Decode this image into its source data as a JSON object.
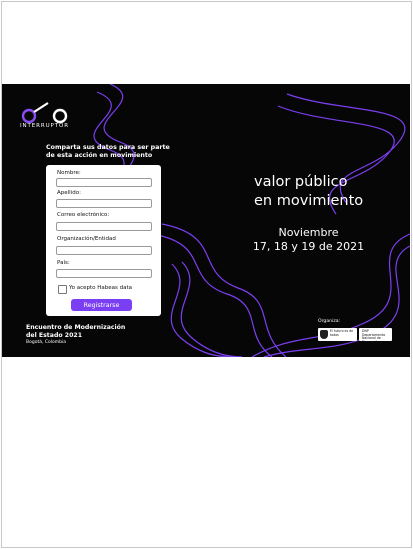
{
  "logo": {
    "text": "INTERRUPTOR"
  },
  "form": {
    "title": "Comparta sus datos para ser parte de esta acción en movimiento",
    "fields": [
      {
        "label": "Nombre:",
        "value": ""
      },
      {
        "label": "Apellido:",
        "value": ""
      },
      {
        "label": "Correo electrónico:",
        "value": ""
      },
      {
        "label": "Organización/Entidad",
        "value": ""
      },
      {
        "label": "País:",
        "value": ""
      }
    ],
    "consent_label": "Yo acepto Habeas data",
    "consent_checked": false,
    "submit_label": "Registrarse"
  },
  "headline": {
    "line1": "valor público",
    "line2": "en movimiento"
  },
  "dates": {
    "month": "Noviembre",
    "days": "17, 18 y 19 de 2021"
  },
  "event": {
    "line1": "Encuentro de Modernización",
    "line2": "del Estado 2021",
    "place": "Bogotá, Colombia"
  },
  "organizers": {
    "label": "Organiza:",
    "org1": "El futuro es de todos",
    "org2": "DNP Departamento Nacional de Planeación"
  },
  "colors": {
    "accent": "#7a3ff2",
    "background": "#060606",
    "waves": "#7b3ff0"
  }
}
